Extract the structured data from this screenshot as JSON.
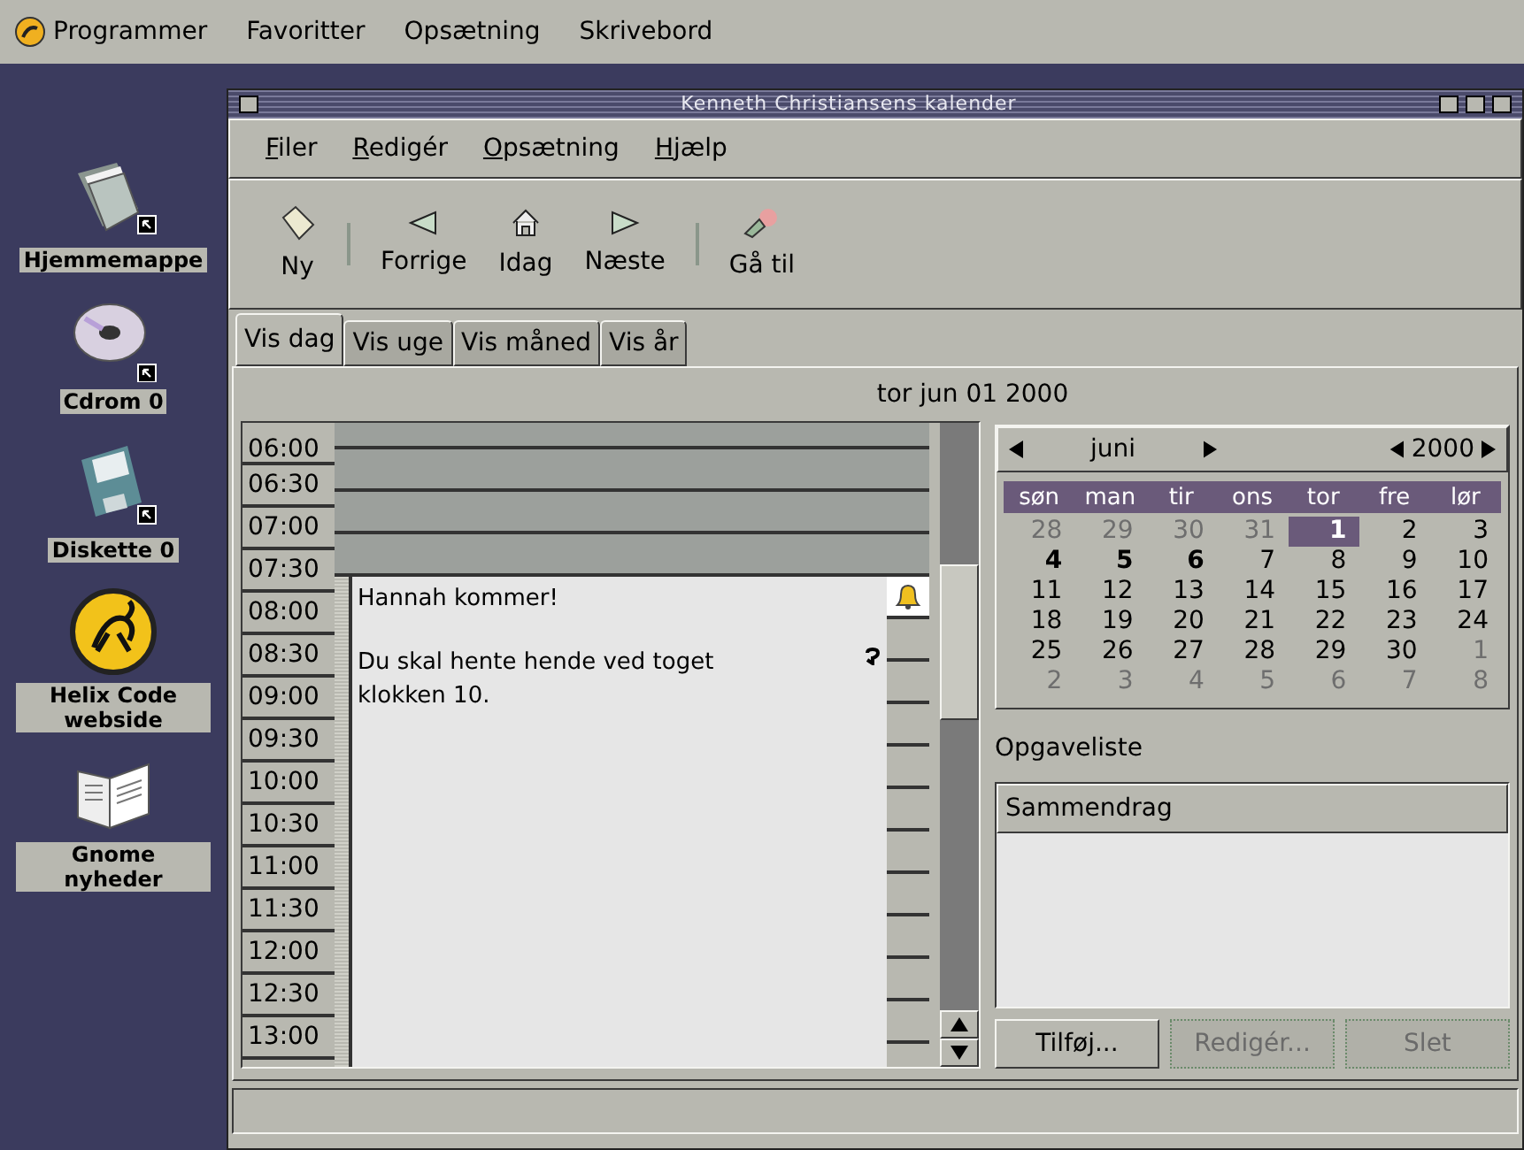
{
  "panel": {
    "menus": [
      {
        "label": "Programmer",
        "kind": "main"
      },
      {
        "label": "Favoritter",
        "kind": "plain"
      },
      {
        "label": "Opsætning",
        "kind": "plain"
      },
      {
        "label": "Skrivebord",
        "kind": "plain"
      }
    ]
  },
  "desktop_icons": [
    {
      "label": "Hjemmemappe",
      "kind": "folder"
    },
    {
      "label": "Cdrom 0",
      "kind": "cdrom"
    },
    {
      "label": "Diskette 0",
      "kind": "floppy"
    },
    {
      "label": "Helix Code webside",
      "kind": "helix"
    },
    {
      "label": "Gnome nyheder",
      "kind": "news"
    }
  ],
  "window": {
    "title": "Kenneth Christiansens kalender"
  },
  "menu": [
    "Filer",
    "Redigér",
    "Opsætning",
    "Hjælp"
  ],
  "toolbar": [
    {
      "label": "Ny",
      "kind": "new"
    },
    {
      "label": "Forrige",
      "kind": "prev"
    },
    {
      "label": "Idag",
      "kind": "home"
    },
    {
      "label": "Næste",
      "kind": "next"
    },
    {
      "label": "Gå til",
      "kind": "goto"
    }
  ],
  "tabs": [
    {
      "label": "Vis dag",
      "selected": true
    },
    {
      "label": "Vis uge",
      "selected": false
    },
    {
      "label": "Vis måned",
      "selected": false
    },
    {
      "label": "Vis år",
      "selected": false
    }
  ],
  "date_header": "tor jun 01 2000",
  "day_view": {
    "slots": [
      {
        "time": "06:00",
        "in_event": false
      },
      {
        "time": "06:30",
        "in_event": false
      },
      {
        "time": "07:00",
        "in_event": false
      },
      {
        "time": "07:30",
        "in_event": false
      },
      {
        "time": "08:00",
        "in_event": true
      },
      {
        "time": "08:30",
        "in_event": true
      },
      {
        "time": "09:00",
        "in_event": true
      },
      {
        "time": "09:30",
        "in_event": true
      },
      {
        "time": "10:00",
        "in_event": true
      },
      {
        "time": "10:30",
        "in_event": true
      },
      {
        "time": "11:00",
        "in_event": true
      },
      {
        "time": "11:30",
        "in_event": true
      },
      {
        "time": "12:00",
        "in_event": true
      },
      {
        "time": "12:30",
        "in_event": true
      },
      {
        "time": "13:00",
        "in_event": true
      }
    ],
    "event": {
      "title": "Hannah kommer!",
      "body": "Du skal hente hende ved toget klokken 10.",
      "alarm": true,
      "recurring": true
    }
  },
  "mini_calendar": {
    "month": "juni",
    "year": "2000",
    "weekdays": [
      "søn",
      "man",
      "tir",
      "ons",
      "tor",
      "fre",
      "lør"
    ],
    "days": [
      {
        "text": "28",
        "kind": "other"
      },
      {
        "text": "29",
        "kind": "other"
      },
      {
        "text": "30",
        "kind": "other"
      },
      {
        "text": "31",
        "kind": "other"
      },
      {
        "text": "1",
        "kind": "day",
        "selected": true,
        "marked": true
      },
      {
        "text": "2",
        "kind": "day",
        "selected": false,
        "marked": false
      },
      {
        "text": "3",
        "kind": "day",
        "selected": false,
        "marked": false
      },
      {
        "text": "4",
        "kind": "day",
        "selected": false,
        "marked": true
      },
      {
        "text": "5",
        "kind": "day",
        "selected": false,
        "marked": true
      },
      {
        "text": "6",
        "kind": "day",
        "selected": false,
        "marked": true
      },
      {
        "text": "7",
        "kind": "day",
        "selected": false,
        "marked": false
      },
      {
        "text": "8",
        "kind": "day",
        "selected": false,
        "marked": false
      },
      {
        "text": "9",
        "kind": "day",
        "selected": false,
        "marked": false
      },
      {
        "text": "10",
        "kind": "day",
        "selected": false,
        "marked": false
      },
      {
        "text": "11",
        "kind": "day",
        "selected": false,
        "marked": false
      },
      {
        "text": "12",
        "kind": "day",
        "selected": false,
        "marked": false
      },
      {
        "text": "13",
        "kind": "day",
        "selected": false,
        "marked": false
      },
      {
        "text": "14",
        "kind": "day",
        "selected": false,
        "marked": false
      },
      {
        "text": "15",
        "kind": "day",
        "selected": false,
        "marked": false
      },
      {
        "text": "16",
        "kind": "day",
        "selected": false,
        "marked": false
      },
      {
        "text": "17",
        "kind": "day",
        "selected": false,
        "marked": false
      },
      {
        "text": "18",
        "kind": "day",
        "selected": false,
        "marked": false
      },
      {
        "text": "19",
        "kind": "day",
        "selected": false,
        "marked": false
      },
      {
        "text": "20",
        "kind": "day",
        "selected": false,
        "marked": false
      },
      {
        "text": "21",
        "kind": "day",
        "selected": false,
        "marked": false
      },
      {
        "text": "22",
        "kind": "day",
        "selected": false,
        "marked": false
      },
      {
        "text": "23",
        "kind": "day",
        "selected": false,
        "marked": false
      },
      {
        "text": "24",
        "kind": "day",
        "selected": false,
        "marked": false
      },
      {
        "text": "25",
        "kind": "day",
        "selected": false,
        "marked": false
      },
      {
        "text": "26",
        "kind": "day",
        "selected": false,
        "marked": false
      },
      {
        "text": "27",
        "kind": "day",
        "selected": false,
        "marked": false
      },
      {
        "text": "28",
        "kind": "day",
        "selected": false,
        "marked": false
      },
      {
        "text": "29",
        "kind": "day",
        "selected": false,
        "marked": false
      },
      {
        "text": "30",
        "kind": "day",
        "selected": false,
        "marked": false
      },
      {
        "text": "1",
        "kind": "other"
      },
      {
        "text": "2",
        "kind": "other"
      },
      {
        "text": "3",
        "kind": "other"
      },
      {
        "text": "4",
        "kind": "other"
      },
      {
        "text": "5",
        "kind": "other"
      },
      {
        "text": "6",
        "kind": "other"
      },
      {
        "text": "7",
        "kind": "other"
      },
      {
        "text": "8",
        "kind": "other"
      }
    ]
  },
  "todo": {
    "label": "Opgaveliste",
    "column": "Sammendrag",
    "buttons": [
      {
        "label": "Tilføj...",
        "disabled": false
      },
      {
        "label": "Redigér...",
        "disabled": true
      },
      {
        "label": "Slet",
        "disabled": true
      }
    ]
  }
}
